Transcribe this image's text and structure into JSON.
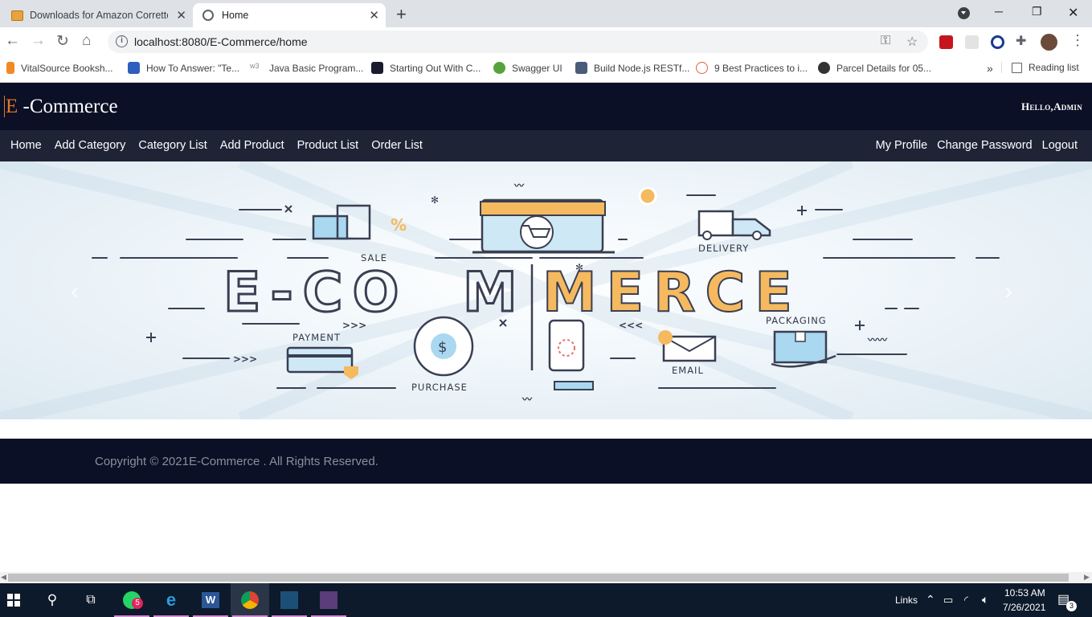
{
  "browser": {
    "tabs": [
      {
        "title": "Downloads for Amazon Corretto",
        "active": false,
        "icon": "package-icon"
      },
      {
        "title": "Home",
        "active": true,
        "icon": "globe-icon"
      }
    ],
    "url": "localhost:8080/E-Commerce/home",
    "bookmarks": [
      {
        "label": "VitalSource Booksh...",
        "color": "#f08a24"
      },
      {
        "label": "How To Answer: \"Te...",
        "color": "#2d5fbf"
      },
      {
        "label": "Java Basic Program...",
        "color": "#9a9a9a"
      },
      {
        "label": "Starting Out With C...",
        "color": "#1a1a2e"
      },
      {
        "label": "Swagger UI",
        "color": "#56a33b"
      },
      {
        "label": "Build Node.js RESTf...",
        "color": "#4a5c7a"
      },
      {
        "label": "9 Best Practices to i...",
        "color": "#e0603a"
      },
      {
        "label": "Parcel Details for 05...",
        "color": "#333333"
      }
    ],
    "reading_list": "Reading list"
  },
  "site": {
    "brand_initial": "E",
    "brand_rest": " -Commerce",
    "greeting": "Hello,Admin",
    "nav_left": [
      "Home",
      "Add Category",
      "Category List",
      "Add Product",
      "Product List",
      "Order List"
    ],
    "nav_right": [
      "My Profile",
      "Change Password",
      "Logout"
    ],
    "banner": {
      "title_part1": "E-CO",
      "title_part2": "M",
      "title_part3": "MERCE",
      "labels": {
        "sale": "SALE",
        "delivery": "DELIVERY",
        "payment": "PAYMENT",
        "purchase": "PURCHASE",
        "email": "EMAIL",
        "packaging": "PACKAGING"
      },
      "accent_color": "#f5b95f",
      "outline_color": "#3a3f52",
      "light_blue": "#a9d8f0"
    },
    "footer": "Copyright © 2021E-Commerce . All Rights Reserved."
  },
  "taskbar": {
    "links_label": "Links",
    "time": "10:53 AM",
    "date": "7/26/2021",
    "whatsapp_badge": "5",
    "notification_count": "3"
  }
}
